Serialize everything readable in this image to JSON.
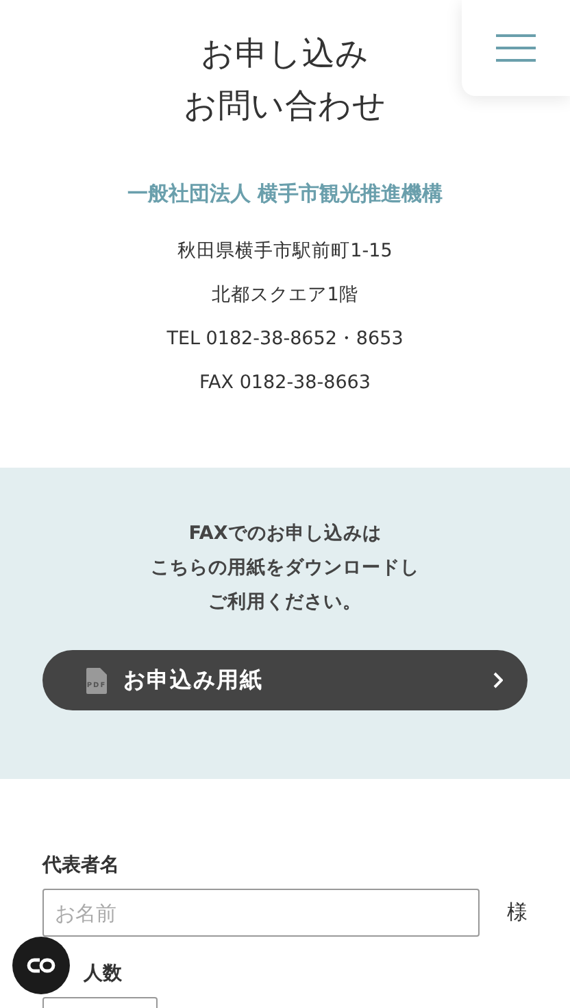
{
  "header": {
    "title_lines": [
      "お申し込み",
      "お問い合わせ"
    ]
  },
  "organization": {
    "name": "一般社団法人 横手市観光推進機構",
    "address_lines": [
      "秋田県横手市駅前町1-15",
      "北都スクエア1階",
      "TEL 0182-38-8652・8653",
      "FAX 0182-38-8663"
    ]
  },
  "fax_section": {
    "lines": [
      "FAXでのお申し込みは",
      "こちらの用紙をダウンロードし",
      "ご利用ください。"
    ],
    "download_button": {
      "label": "お申込み用紙",
      "icon_label": "PDF"
    }
  },
  "form": {
    "fields": [
      {
        "label": "代表者名",
        "placeholder": "お名前",
        "suffix": "様",
        "kind": "wide"
      },
      {
        "label": "人数",
        "kind": "narrow"
      }
    ]
  }
}
